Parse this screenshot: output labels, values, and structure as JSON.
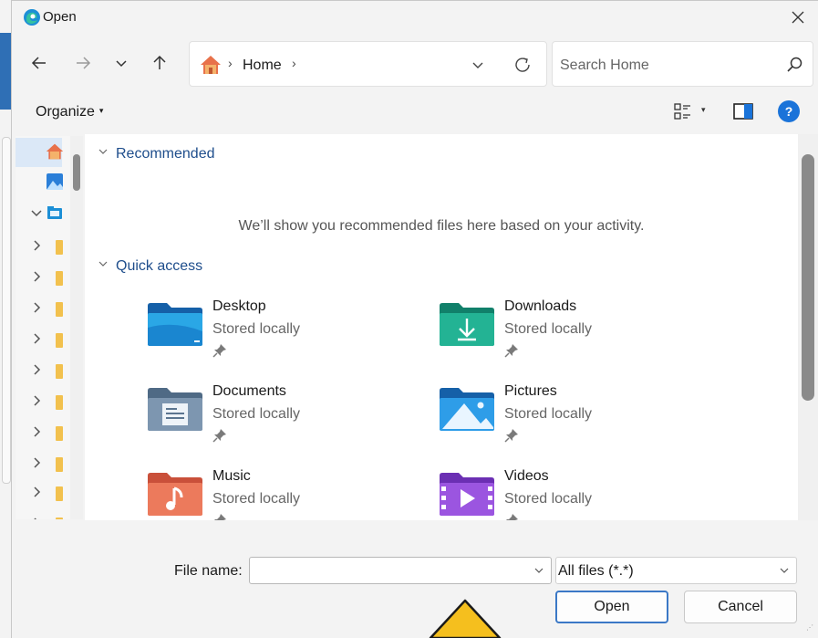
{
  "window": {
    "title": "Open"
  },
  "address": {
    "crumb": "Home"
  },
  "search": {
    "placeholder": "Search Home"
  },
  "toolbar": {
    "organize_label": "Organize"
  },
  "recommended": {
    "header": "Recommended",
    "empty_message": "We’ll show you recommended files here based on your activity."
  },
  "quick_access": {
    "header": "Quick access",
    "items": [
      {
        "name": "Desktop",
        "status": "Stored locally",
        "icon": "desktop-folder-icon"
      },
      {
        "name": "Downloads",
        "status": "Stored locally",
        "icon": "downloads-folder-icon"
      },
      {
        "name": "Documents",
        "status": "Stored locally",
        "icon": "documents-folder-icon"
      },
      {
        "name": "Pictures",
        "status": "Stored locally",
        "icon": "pictures-folder-icon"
      },
      {
        "name": "Music",
        "status": "Stored locally",
        "icon": "music-folder-icon"
      },
      {
        "name": "Videos",
        "status": "Stored locally",
        "icon": "videos-folder-icon"
      }
    ]
  },
  "footer": {
    "file_name_label": "File name:",
    "file_name_value": "",
    "file_type": "All files (*.*)",
    "open_label": "Open",
    "cancel_label": "Cancel"
  },
  "colors": {
    "accent": "#1a73d9",
    "section_header": "#1f4e8c",
    "selection": "#dbe8f7"
  }
}
